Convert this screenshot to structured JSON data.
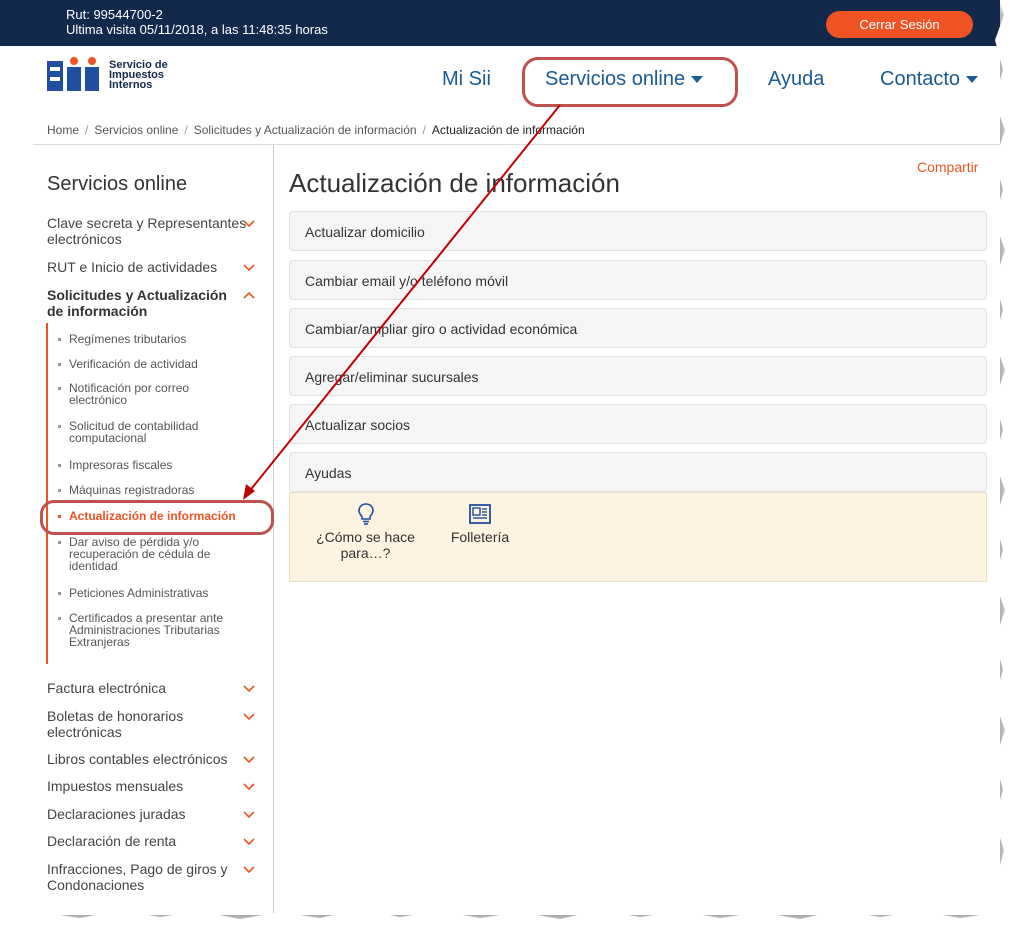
{
  "topbar": {
    "rut": "Rut: 99544700-2",
    "last_visit": "Ultima visita 05/11/2018, a las 11:48:35 horas",
    "logout_label": "Cerrar Sesión"
  },
  "logo": {
    "mark": "Sii",
    "line1": "Servicio de",
    "line2": "Impuestos",
    "line3": "Internos"
  },
  "nav": {
    "mi_sii": "Mi Sii",
    "servicios": "Servicios online",
    "ayuda": "Ayuda",
    "contacto": "Contacto"
  },
  "breadcrumb": {
    "home": "Home",
    "servicios": "Servicios online",
    "solicitudes": "Solicitudes y Actualización de información",
    "current": "Actualización de información"
  },
  "sidebar": {
    "title": "Servicios online",
    "items": [
      {
        "label": "Clave secreta y Representantes electrónicos"
      },
      {
        "label": "RUT e Inicio de actividades"
      },
      {
        "label": "Solicitudes y Actualización de información"
      },
      {
        "label": "Factura electrónica"
      },
      {
        "label": "Boletas de honorarios electrónicas"
      },
      {
        "label": "Libros contables electrónicos"
      },
      {
        "label": "Impuestos mensuales"
      },
      {
        "label": "Declaraciones juradas"
      },
      {
        "label": "Declaración de renta"
      },
      {
        "label": "Infracciones, Pago de giros y Condonaciones"
      }
    ],
    "subitems": [
      {
        "label": "Regímenes tributarios"
      },
      {
        "label": "Verificación de actividad"
      },
      {
        "label": "Notificación por correo electrónico"
      },
      {
        "label": "Solicitud de contabilidad computacional"
      },
      {
        "label": "Impresoras fiscales"
      },
      {
        "label": "Máquinas registradoras"
      },
      {
        "label": "Actualización de información"
      },
      {
        "label": "Dar aviso de pérdida y/o recuperación de cédula de identidad"
      },
      {
        "label": "Peticiones Administrativas"
      },
      {
        "label": "Certificados a presentar ante Administraciones Tributarias Extranjeras"
      }
    ]
  },
  "main": {
    "share": "Compartir",
    "title": "Actualización de información",
    "panels": [
      {
        "label": "Actualizar domicilio"
      },
      {
        "label": "Cambiar email y/o teléfono móvil"
      },
      {
        "label": "Cambiar/ampliar giro o actividad económica"
      },
      {
        "label": "Agregar/eliminar sucursales"
      },
      {
        "label": "Actualizar socios"
      },
      {
        "label": "Ayudas"
      }
    ],
    "help": {
      "como": "¿Cómo se hace para…?",
      "folleteria": "Folletería"
    }
  },
  "colors": {
    "navy": "#13294b",
    "accent": "#f05323",
    "link": "#1a5b94",
    "annotation": "#c0504d"
  }
}
